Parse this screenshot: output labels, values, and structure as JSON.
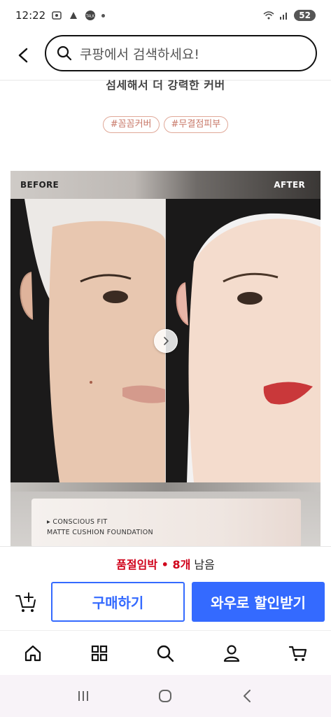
{
  "status_bar": {
    "time": "12:22",
    "battery": "52",
    "icons": [
      "screenshot-icon",
      "app-icon",
      "talk-icon",
      "wifi-icon",
      "signal-icon"
    ]
  },
  "header": {
    "search_placeholder": "쿠팡에서 검색하세요!",
    "icons": [
      "back-arrow-icon",
      "search-icon"
    ]
  },
  "content": {
    "tagline": "섬세해서 더 강력한 커버",
    "tags": [
      "#꼼꼼커버",
      "#무결점피부"
    ],
    "before_after": {
      "before_label": "BEFORE",
      "after_label": "AFTER"
    },
    "product_text_line1": "▸ CONSCIOUS FIT",
    "product_text_line2": "MATTE CUSHION FOUNDATION"
  },
  "purchase": {
    "stock_prefix": "품절임박",
    "stock_sep": " • ",
    "stock_count": "8개",
    "stock_suffix": " 남음",
    "buy_label": "구매하기",
    "wow_label": "와우로 할인받기",
    "accent_color": "#346aff",
    "warn_color": "#d0021b"
  },
  "tabbar": {
    "tabs": [
      "home-icon",
      "categories-icon",
      "search-icon",
      "my-account-icon",
      "cart-icon"
    ]
  },
  "sysnav": {
    "buttons": [
      "recent-apps-icon",
      "home-circle-icon",
      "back-icon"
    ]
  }
}
